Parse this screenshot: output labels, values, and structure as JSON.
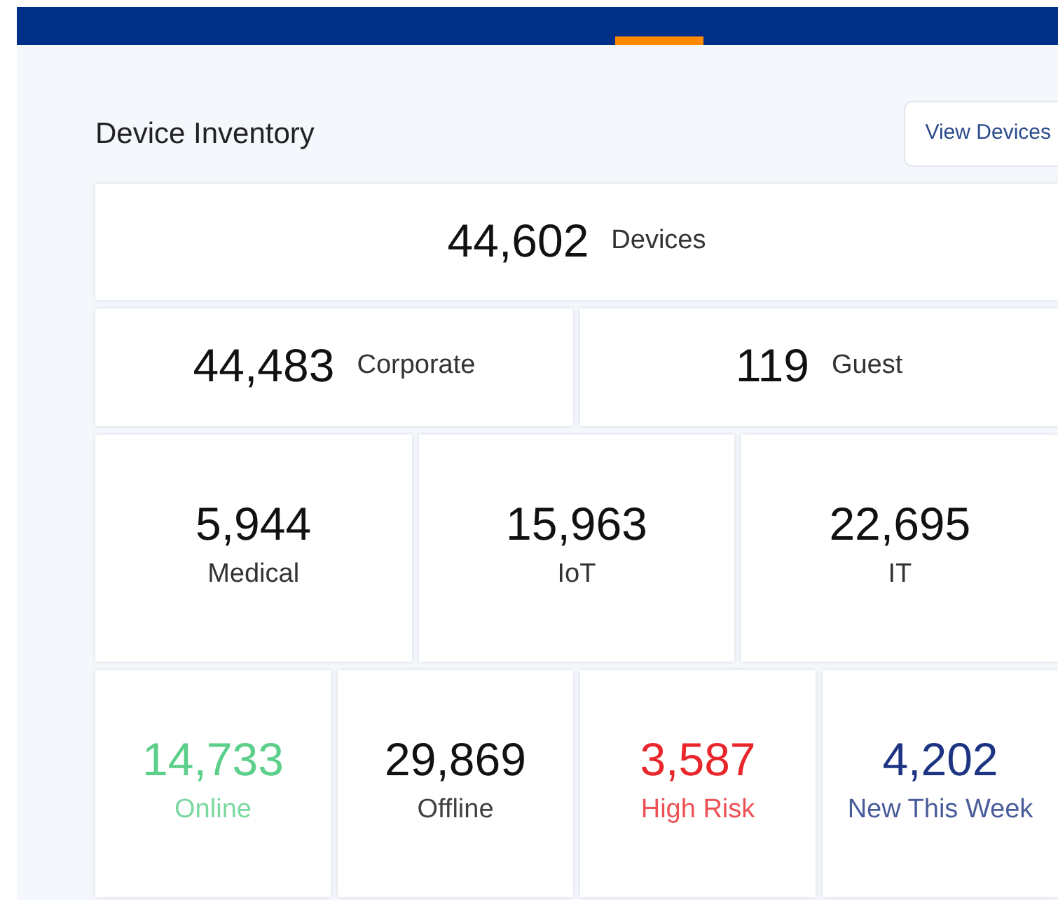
{
  "header": {
    "tab_indicator": true
  },
  "title": "Device Inventory",
  "action_button": "View Devices",
  "total": {
    "value": "44,602",
    "label": "Devices"
  },
  "rows": [
    [
      {
        "value": "44,483",
        "label": "Corporate",
        "kind": "inline"
      },
      {
        "value": "119",
        "label": "Guest",
        "kind": "inline"
      }
    ],
    [
      {
        "value": "5,944",
        "label": "Medical",
        "kind": "stacked"
      },
      {
        "value": "15,963",
        "label": "IoT",
        "kind": "stacked"
      },
      {
        "value": "22,695",
        "label": "IT",
        "kind": "stacked"
      }
    ],
    [
      {
        "value": "14,733",
        "label": "Online",
        "kind": "status",
        "color": "#5ccf8a"
      },
      {
        "value": "29,869",
        "label": "Offline",
        "kind": "status",
        "color": "#111111"
      },
      {
        "value": "3,587",
        "label": "High Risk",
        "kind": "status",
        "color": "#e8262c"
      },
      {
        "value": "4,202",
        "label": "New This Week",
        "kind": "status",
        "color": "#1c3482"
      }
    ]
  ]
}
